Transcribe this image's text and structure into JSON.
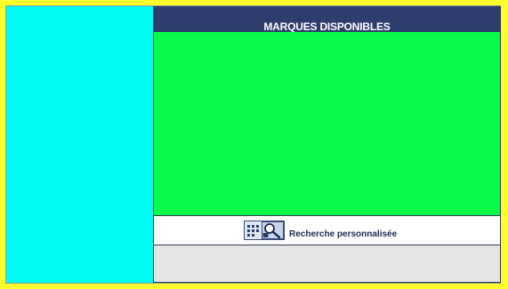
{
  "panel": {
    "title": "MARQUES DISPONIBLES"
  },
  "search": {
    "label": "Recherche personnalisée",
    "icon": "advanced-search-icon"
  },
  "colors": {
    "frame": "#ffff2e",
    "left_panel": "#00fbf4",
    "header": "#2e3e6c",
    "content": "#0afa4a",
    "footer": "#e5e5e5"
  }
}
